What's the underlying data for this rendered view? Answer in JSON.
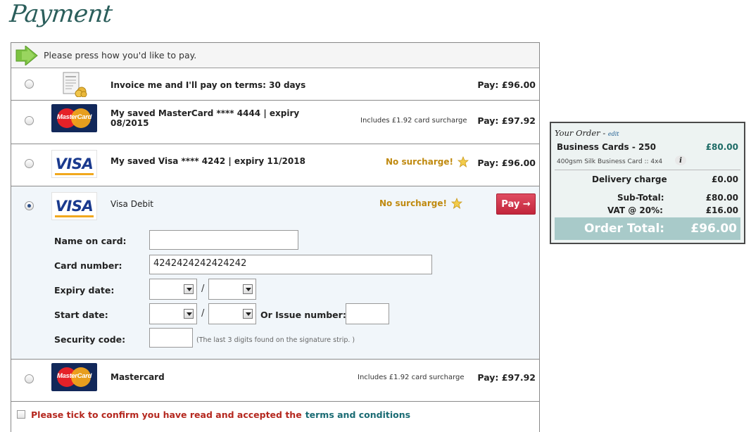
{
  "page": {
    "title": "Payment"
  },
  "header": {
    "instruction": "Please press how you'd like to pay."
  },
  "options": {
    "invoice": {
      "label": "Invoice me and I'll pay on terms: 30 days",
      "amount": "Pay: £96.00"
    },
    "saved_mastercard": {
      "label_line1": "My saved MasterCard **** 4444 | expiry",
      "label_line2": "08/2015",
      "surcharge": "Includes £1.92 card surcharge",
      "amount": "Pay: £97.92",
      "logo_text": "MasterCard"
    },
    "saved_visa": {
      "label": "My saved Visa **** 4242 | expiry 11/2018",
      "surcharge": "No surcharge!",
      "amount": "Pay: £96.00",
      "logo_text": "VISA"
    },
    "visa_debit": {
      "label": "Visa Debit",
      "surcharge": "No surcharge!",
      "pay_button": "Pay →",
      "logo_text": "VISA"
    },
    "mastercard": {
      "label": "Mastercard",
      "surcharge": "Includes £1.92 card surcharge",
      "amount": "Pay: £97.92",
      "logo_text": "MasterCard"
    }
  },
  "card_form": {
    "name_label": "Name on card:",
    "name_value": "",
    "number_label": "Card number:",
    "number_value": "4242424242424242",
    "expiry_label": "Expiry date:",
    "start_label": "Start date:",
    "issue_label": "Or Issue number:",
    "security_label": "Security code:",
    "security_hint": "(The last 3 digits found on the signature strip. )",
    "separator": "/"
  },
  "terms": {
    "text": "Please tick to confirm you have read and accepted the",
    "link": "terms and conditions"
  },
  "order": {
    "title": "Your Order",
    "separator": " - ",
    "edit": "edit",
    "item_name": "Business Cards - 250",
    "item_price": "£80.00",
    "item_detail": "400gsm Silk Business Card :: 4x4",
    "delivery_label": "Delivery charge",
    "delivery_value": "£0.00",
    "subtotal_label": "Sub-Total:",
    "subtotal_value": "£80.00",
    "vat_label": "VAT @ 20%:",
    "vat_value": "£16.00",
    "total_label": "Order Total:",
    "total_value": "£96.00"
  },
  "icons": {
    "arrow": "arrow-right-icon",
    "invoice": "invoice-icon",
    "star": "star-icon",
    "info": "info-icon"
  },
  "colors": {
    "title": "#2b5e5b",
    "pay_button": "#c2253b",
    "no_surcharge": "#c08a10",
    "terms_text": "#b5281f",
    "order_total_bar": "#a8cac9",
    "selected_row_bg": "#f1f6fa"
  }
}
